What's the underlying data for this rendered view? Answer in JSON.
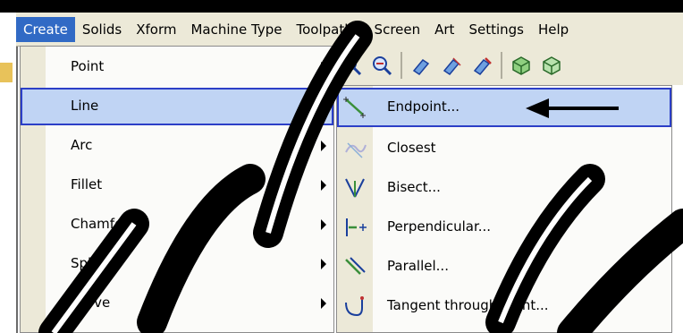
{
  "menubar": {
    "items": [
      {
        "label": "Create",
        "active": true
      },
      {
        "label": "Solids"
      },
      {
        "label": "Xform"
      },
      {
        "label": "Machine Type"
      },
      {
        "label": "Toolpaths"
      },
      {
        "label": "Screen"
      },
      {
        "label": "Art"
      },
      {
        "label": "Settings"
      },
      {
        "label": "Help"
      }
    ]
  },
  "create_menu": {
    "items": [
      {
        "label": "Point"
      },
      {
        "label": "Line",
        "highlighted": true
      },
      {
        "label": "Arc"
      },
      {
        "label": "Fillet"
      },
      {
        "label": "Chamfer"
      },
      {
        "label": "Spline"
      },
      {
        "label": "Curve"
      }
    ]
  },
  "line_submenu": {
    "items": [
      {
        "label": "Endpoint...",
        "icon": "line-endpoint-icon",
        "highlighted": true
      },
      {
        "label": "Closest",
        "icon": "line-closest-icon"
      },
      {
        "label": "Bisect...",
        "icon": "line-bisect-icon"
      },
      {
        "label": "Perpendicular...",
        "icon": "line-perpendicular-icon"
      },
      {
        "label": "Parallel...",
        "icon": "line-parallel-icon"
      },
      {
        "label": "Tangent through point...",
        "icon": "line-tangent-icon"
      }
    ]
  },
  "colors": {
    "menu_active": "#316ac5",
    "highlight_fill": "#c0d4f4",
    "highlight_border": "#2c3fc7",
    "menu_bg": "#ece9d8"
  }
}
